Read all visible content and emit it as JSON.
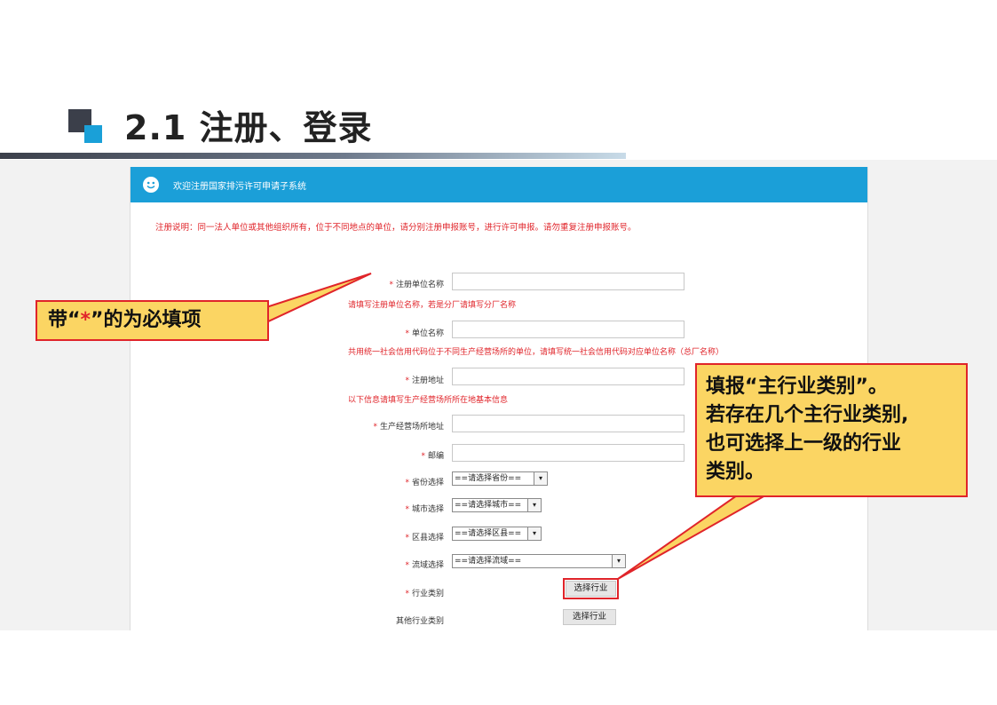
{
  "slide": {
    "title": "2.1  注册、登录"
  },
  "app": {
    "header_title": "欢迎注册国家排污许可申请子系统",
    "notice": "注册说明：同一法人单位或其他组织所有，位于不同地点的单位，请分别注册申报账号，进行许可申报。请勿重复注册申报账号。"
  },
  "form": {
    "required_mark": "*",
    "fields": [
      {
        "label": "注册单位名称",
        "hint": "请填写注册单位名称，若是分厂请填写分厂名称"
      },
      {
        "label": "单位名称",
        "hint": "共用统一社会信用代码位于不同生产经营场所的单位，请填写统一社会信用代码对应单位名称（总厂名称）"
      },
      {
        "label": "注册地址",
        "hint": "以下信息请填写生产经营场所所在地基本信息"
      },
      {
        "label": "生产经营场所地址"
      },
      {
        "label": "邮编"
      }
    ],
    "selects": [
      {
        "label": "省份选择",
        "value": "==请选择省份=="
      },
      {
        "label": "城市选择",
        "value": "==请选择城市=="
      },
      {
        "label": "区县选择",
        "value": "==请选择区县=="
      },
      {
        "label": "流域选择",
        "value": "==请选择流域=="
      }
    ],
    "industry_label": "行业类别",
    "industry_button": "选择行业",
    "other_industry_label": "其他行业类别",
    "other_industry_button": "选择行业",
    "arrow_glyph": "▾"
  },
  "callouts": {
    "required": {
      "prefix": "带“",
      "star": "*",
      "suffix": "”的为必填项"
    },
    "industry": {
      "lines": [
        "填报“主行业类别”。",
        "若存在几个主行业类别,",
        "也可选择上一级的行业",
        "类别。"
      ]
    }
  },
  "colors": {
    "accent_blue": "#1b9fd8",
    "required_red": "#e0242a",
    "callout_yellow": "#fbd563"
  }
}
